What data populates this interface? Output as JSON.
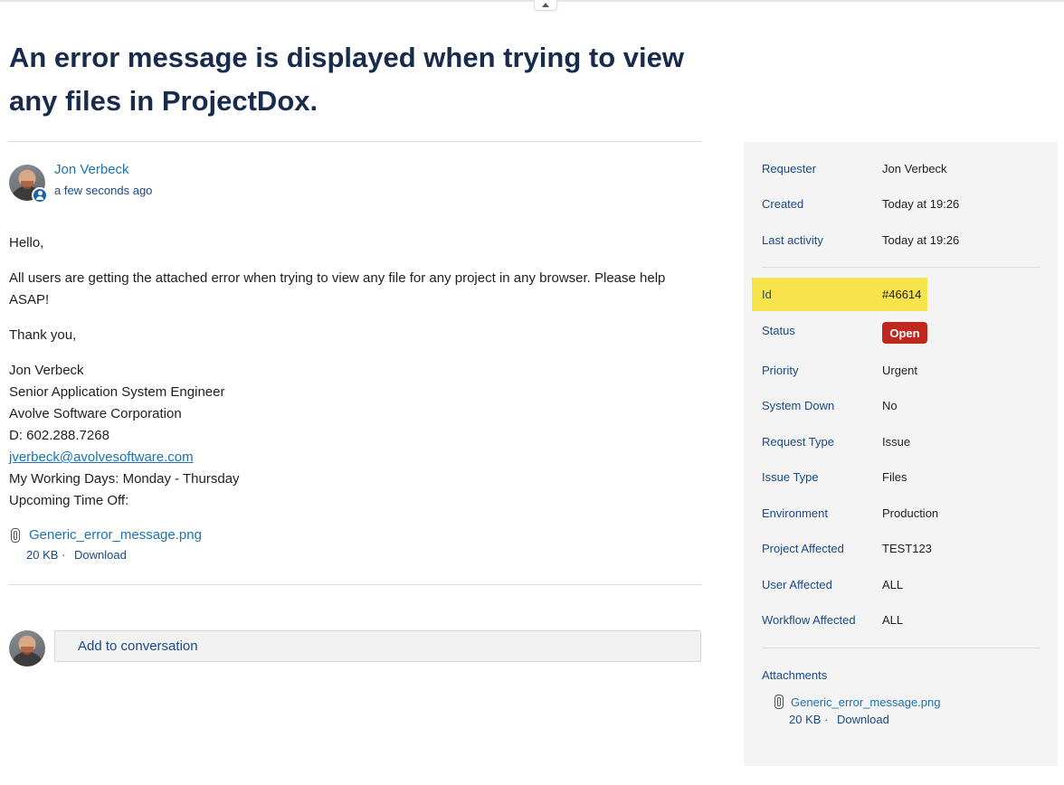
{
  "ticket": {
    "title": "An error message is displayed when trying to view any files in ProjectDox."
  },
  "comment": {
    "author": "Jon Verbeck",
    "time": "a few seconds ago",
    "greeting": "Hello,",
    "body": "All users are getting the attached error when trying to view any file for any project in any browser. Please help ASAP!",
    "closing": "Thank you,",
    "signature": {
      "name": "Jon Verbeck",
      "title": "Senior Application System Engineer",
      "company": "Avolve Software Corporation",
      "phone": "D: 602.288.7268",
      "email": "jverbeck@avolvesoftware.com",
      "working_days": "My Working Days: Monday - Thursday",
      "time_off": "Upcoming Time Off:"
    },
    "attachment": {
      "name": "Generic_error_message.png",
      "size": "20 KB",
      "separator": "·",
      "download": "Download"
    }
  },
  "reply": {
    "placeholder": "Add to conversation"
  },
  "sidebar": {
    "requester": {
      "label": "Requester",
      "value": "Jon Verbeck"
    },
    "created": {
      "label": "Created",
      "value": "Today at 19:26"
    },
    "last_activity": {
      "label": "Last activity",
      "value": "Today at 19:26"
    },
    "id": {
      "label": "Id",
      "value": "#46614"
    },
    "status": {
      "label": "Status",
      "value": "Open"
    },
    "fields": [
      {
        "label": "Priority",
        "value": "Urgent"
      },
      {
        "label": "System Down",
        "value": "No"
      },
      {
        "label": "Request Type",
        "value": "Issue"
      },
      {
        "label": "Issue Type",
        "value": "Files"
      },
      {
        "label": "Environment",
        "value": "Production"
      },
      {
        "label": "Project Affected",
        "value": "TEST123"
      },
      {
        "label": "User Affected",
        "value": "ALL"
      },
      {
        "label": "Workflow Affected",
        "value": "ALL"
      }
    ],
    "attachments": {
      "title": "Attachments",
      "file": {
        "name": "Generic_error_message.png",
        "size": "20 KB",
        "separator": "·",
        "download": "Download"
      }
    }
  },
  "colors": {
    "title": "#172b4d",
    "link": "#1a73b5",
    "label": "#1a4a8a",
    "highlight": "#f7e34b",
    "status_open": "#c0281e",
    "sidebar_bg": "#f4f4f4"
  }
}
